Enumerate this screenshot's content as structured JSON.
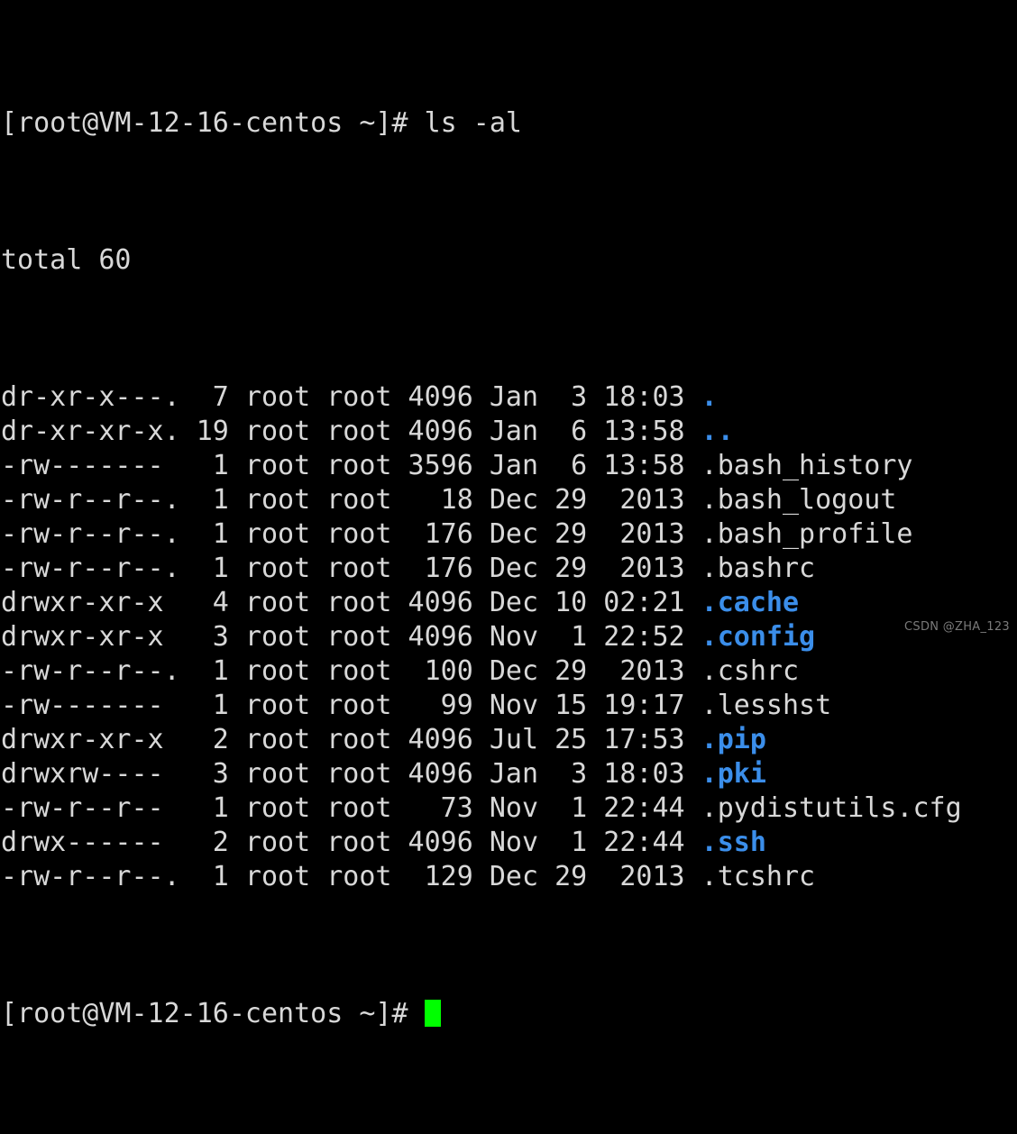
{
  "terminal": {
    "background_color": "#000000",
    "foreground_color": "#d8d8d8",
    "directory_color": "#3b8eea",
    "cursor_color": "#00ff00",
    "prompt": "[root@VM-12-16-centos ~]#",
    "command": "ls -al",
    "total_line": "total 60",
    "prompt_line_1": "[root@VM-12-16-centos ~]# ls -al",
    "prompt_line_last": "[root@VM-12-16-centos ~]# ",
    "rows": [
      {
        "permissions": "dr-xr-x---.",
        "links": "7",
        "owner": "root",
        "group": "root",
        "size": "4096",
        "month": "Jan",
        "day": "3",
        "time": "18:03",
        "name": ".",
        "is_dir": true,
        "text": "dr-xr-x---.  7 root root 4096 Jan  3 18:03 ",
        "name_text": "."
      },
      {
        "permissions": "dr-xr-xr-x.",
        "links": "19",
        "owner": "root",
        "group": "root",
        "size": "4096",
        "month": "Jan",
        "day": "6",
        "time": "13:58",
        "name": "..",
        "is_dir": true,
        "text": "dr-xr-xr-x. 19 root root 4096 Jan  6 13:58 ",
        "name_text": ".."
      },
      {
        "permissions": "-rw-------",
        "links": "1",
        "owner": "root",
        "group": "root",
        "size": "3596",
        "month": "Jan",
        "day": "6",
        "time": "13:58",
        "name": ".bash_history",
        "is_dir": false,
        "text": "-rw-------   1 root root 3596 Jan  6 13:58 ",
        "name_text": ".bash_history"
      },
      {
        "permissions": "-rw-r--r--.",
        "links": "1",
        "owner": "root",
        "group": "root",
        "size": "18",
        "month": "Dec",
        "day": "29",
        "time": "2013",
        "name": ".bash_logout",
        "is_dir": false,
        "text": "-rw-r--r--.  1 root root   18 Dec 29  2013 ",
        "name_text": ".bash_logout"
      },
      {
        "permissions": "-rw-r--r--.",
        "links": "1",
        "owner": "root",
        "group": "root",
        "size": "176",
        "month": "Dec",
        "day": "29",
        "time": "2013",
        "name": ".bash_profile",
        "is_dir": false,
        "text": "-rw-r--r--.  1 root root  176 Dec 29  2013 ",
        "name_text": ".bash_profile"
      },
      {
        "permissions": "-rw-r--r--.",
        "links": "1",
        "owner": "root",
        "group": "root",
        "size": "176",
        "month": "Dec",
        "day": "29",
        "time": "2013",
        "name": ".bashrc",
        "is_dir": false,
        "text": "-rw-r--r--.  1 root root  176 Dec 29  2013 ",
        "name_text": ".bashrc"
      },
      {
        "permissions": "drwxr-xr-x",
        "links": "4",
        "owner": "root",
        "group": "root",
        "size": "4096",
        "month": "Dec",
        "day": "10",
        "time": "02:21",
        "name": ".cache",
        "is_dir": true,
        "text": "drwxr-xr-x   4 root root 4096 Dec 10 02:21 ",
        "name_text": ".cache"
      },
      {
        "permissions": "drwxr-xr-x",
        "links": "3",
        "owner": "root",
        "group": "root",
        "size": "4096",
        "month": "Nov",
        "day": "1",
        "time": "22:52",
        "name": ".config",
        "is_dir": true,
        "text": "drwxr-xr-x   3 root root 4096 Nov  1 22:52 ",
        "name_text": ".config"
      },
      {
        "permissions": "-rw-r--r--.",
        "links": "1",
        "owner": "root",
        "group": "root",
        "size": "100",
        "month": "Dec",
        "day": "29",
        "time": "2013",
        "name": ".cshrc",
        "is_dir": false,
        "text": "-rw-r--r--.  1 root root  100 Dec 29  2013 ",
        "name_text": ".cshrc"
      },
      {
        "permissions": "-rw-------",
        "links": "1",
        "owner": "root",
        "group": "root",
        "size": "99",
        "month": "Nov",
        "day": "15",
        "time": "19:17",
        "name": ".lesshst",
        "is_dir": false,
        "text": "-rw-------   1 root root   99 Nov 15 19:17 ",
        "name_text": ".lesshst"
      },
      {
        "permissions": "drwxr-xr-x",
        "links": "2",
        "owner": "root",
        "group": "root",
        "size": "4096",
        "month": "Jul",
        "day": "25",
        "time": "17:53",
        "name": ".pip",
        "is_dir": true,
        "text": "drwxr-xr-x   2 root root 4096 Jul 25 17:53 ",
        "name_text": ".pip"
      },
      {
        "permissions": "drwxrw----",
        "links": "3",
        "owner": "root",
        "group": "root",
        "size": "4096",
        "month": "Jan",
        "day": "3",
        "time": "18:03",
        "name": ".pki",
        "is_dir": true,
        "text": "drwxrw----   3 root root 4096 Jan  3 18:03 ",
        "name_text": ".pki"
      },
      {
        "permissions": "-rw-r--r--",
        "links": "1",
        "owner": "root",
        "group": "root",
        "size": "73",
        "month": "Nov",
        "day": "1",
        "time": "22:44",
        "name": ".pydistutils.cfg",
        "is_dir": false,
        "text": "-rw-r--r--   1 root root   73 Nov  1 22:44 ",
        "name_text": ".pydistutils.cfg"
      },
      {
        "permissions": "drwx------",
        "links": "2",
        "owner": "root",
        "group": "root",
        "size": "4096",
        "month": "Nov",
        "day": "1",
        "time": "22:44",
        "name": ".ssh",
        "is_dir": true,
        "text": "drwx------   2 root root 4096 Nov  1 22:44 ",
        "name_text": ".ssh"
      },
      {
        "permissions": "-rw-r--r--.",
        "links": "1",
        "owner": "root",
        "group": "root",
        "size": "129",
        "month": "Dec",
        "day": "29",
        "time": "2013",
        "name": ".tcshrc",
        "is_dir": false,
        "text": "-rw-r--r--.  1 root root  129 Dec 29  2013 ",
        "name_text": ".tcshrc"
      }
    ]
  },
  "watermark": {
    "text": "CSDN @ZHA_123"
  }
}
